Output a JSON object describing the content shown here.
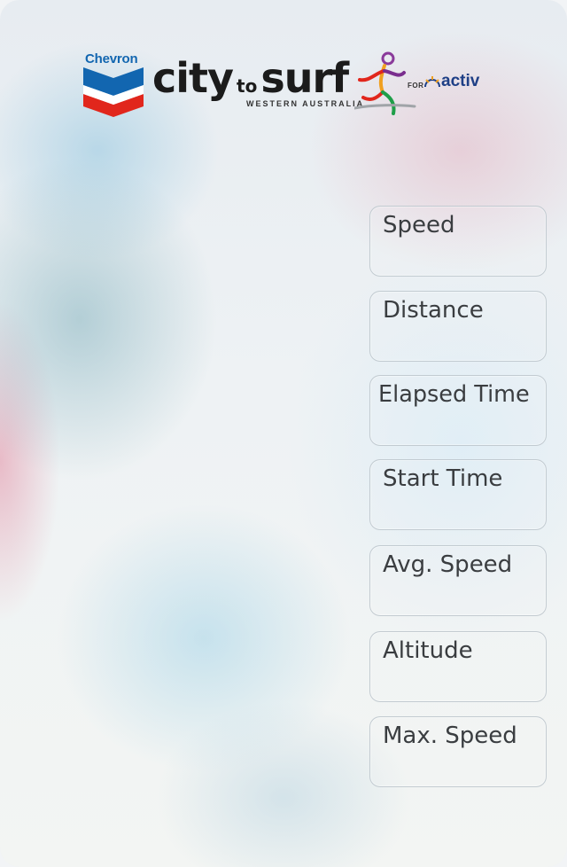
{
  "header": {
    "sponsor": "Chevron",
    "title_part1": "city",
    "title_connector": "to",
    "title_part2": "surf",
    "subtitle": "WESTERN AUSTRALIA",
    "for_label": "FOR",
    "partner": "activ"
  },
  "stats": [
    {
      "label": "Speed"
    },
    {
      "label": "Distance"
    },
    {
      "label": "Elapsed Time"
    },
    {
      "label": "Start Time"
    },
    {
      "label": "Avg. Speed"
    },
    {
      "label": "Altitude"
    },
    {
      "label": "Max. Speed"
    }
  ],
  "colors": {
    "chevron_blue": "#1266b0",
    "chevron_red": "#e1261c",
    "activ_blue": "#1e3f86"
  }
}
